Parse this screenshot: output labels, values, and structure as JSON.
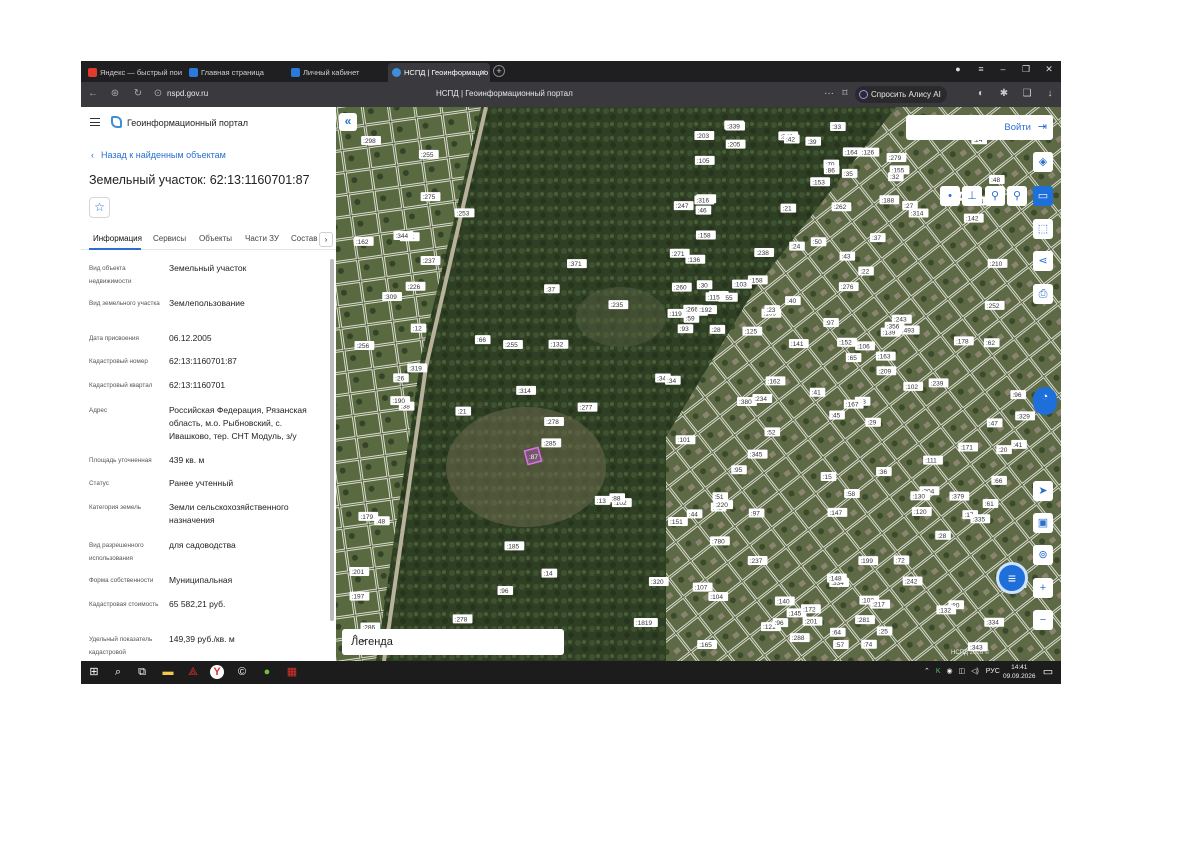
{
  "browser": {
    "tabs": [
      {
        "label": "Яндекс — быстрый поиск",
        "color": "#e23b2e"
      },
      {
        "label": "Главная страница",
        "color": "#2a7bd9"
      },
      {
        "label": "Личный кабинет",
        "color": "#2a7bd9"
      },
      {
        "label": "НСПД | Геоинформацио",
        "color": "#3c8fd8",
        "active": true
      }
    ],
    "url": "nspd.gov.ru",
    "page_title": "НСПД | Геоинформационный портал",
    "alisa_label": "Спросить Алису AI"
  },
  "header": {
    "portal_name": "Геоинформационный портал"
  },
  "panel": {
    "back_label": "Назад к найденным объектам",
    "title": "Земельный участок: 62:13:1160701:87",
    "tabs": [
      "Информация",
      "Сервисы",
      "Объекты",
      "Части ЗУ",
      "Состав"
    ],
    "properties": [
      {
        "label": "Вид объекта недвижимости",
        "value": "Земельный участок"
      },
      {
        "label": "Вид земельного участка",
        "value": "Землепользование"
      },
      {
        "label": "Дата присвоения",
        "value": "06.12.2005"
      },
      {
        "label": "Кадастровый номер",
        "value": "62:13:1160701:87"
      },
      {
        "label": "Кадастровый квартал",
        "value": "62:13:1160701"
      },
      {
        "label": "Адрес",
        "value": "Российская Федерация, Рязанская область, м.о. Рыбновский, с. Ивашково, тер. СНТ Модуль, з/у"
      },
      {
        "label": "Площадь уточненная",
        "value": "439 кв. м"
      },
      {
        "label": "Статус",
        "value": "Ранее учтенный"
      },
      {
        "label": "Категория земель",
        "value": "Земли сельскохозяйственного назначения"
      },
      {
        "label": "Вид разрешенного использования",
        "value": "для садоводства"
      },
      {
        "label": "Форма собственности",
        "value": "Муниципальная"
      },
      {
        "label": "Кадастровая стоимость",
        "value": "65 582,21 руб."
      },
      {
        "label": "Удельный показатель кадастровой",
        "value": "149,39 руб./кв. м"
      }
    ]
  },
  "map": {
    "login_label": "Войти",
    "legend_label": "Легенда",
    "credit": "НСПД 2026 ©",
    "selected_parcel": ":87",
    "parcel_labels": [
      ":38",
      ":162",
      ":26",
      ":201",
      ":12",
      ":48",
      ":255",
      ":241",
      ":275",
      ":319",
      ":298",
      ":278",
      ":256",
      ":253",
      ":190",
      ":237",
      ":286",
      ":344",
      ":226",
      ":179",
      ":309",
      ":197",
      ":96",
      ":132",
      ":277",
      ":102",
      ":66",
      ":37",
      ":21",
      ":13",
      ":34",
      ":285",
      ":14",
      ":278",
      ":255",
      ":235",
      ":185",
      ":1819",
      ":320",
      ":88",
      ":371",
      ":314",
      ":125",
      ":120",
      ":121",
      ":119",
      ":163",
      ":165",
      ":334",
      ":209",
      ":780",
      ":210",
      ":247",
      ":204",
      ":242",
      ":237",
      ":205",
      ":203",
      ":199",
      ":184",
      ":164",
      ":162",
      ":160",
      ":158",
      ":156",
      ":159",
      ":155",
      ":153",
      ":152",
      ":151",
      ":147",
      ":145",
      ":111",
      ":109",
      ":107",
      ":105",
      ":103",
      ":101",
      ":97",
      ":108",
      ":106",
      ":104",
      ":102",
      ":66",
      ":64",
      ":62",
      ":58",
      ":80",
      ":74",
      ":72",
      ":70",
      ":329",
      ":493",
      ":28",
      ":65",
      ":61",
      ":59",
      ":57",
      ":27",
      ":314",
      ":380",
      ":343",
      ":96",
      ":93",
      ":95",
      ":97",
      ":140",
      ":139",
      ":142",
      ":141",
      ":47",
      ":46",
      ":43",
      ":41",
      ":42",
      ":44",
      ":45",
      ":48",
      ":50",
      ":39",
      ":42",
      ":24",
      ":22",
      ":24",
      ":239",
      ":345",
      ":334",
      ":201",
      ":178",
      ":158",
      ":220",
      ":25",
      ":23",
      ":21",
      ":20",
      ":379",
      ":52",
      ":51",
      ":41",
      ":40",
      ":29",
      ":28",
      ":17",
      ":18",
      ":356",
      ":329",
      ":172",
      ":132",
      ":148",
      ":86",
      ":252",
      ":238",
      ":266",
      ":288",
      ":171",
      ":126",
      ":262",
      ":276",
      ":234",
      ":37",
      ":36",
      ":35",
      ":34",
      ":33",
      ":32",
      ":30",
      ":15",
      ":18",
      ":339",
      ":343",
      ":335",
      ":217",
      ":260",
      ":279",
      ":243",
      ":96",
      ":188",
      ":130",
      ":271",
      ":149",
      ":136",
      ":167",
      ":281",
      ":192",
      ":316",
      ":255",
      ":115"
    ]
  },
  "taskbar": {
    "lang": "РУС",
    "time": "14:41",
    "date": "09.09.2026"
  }
}
